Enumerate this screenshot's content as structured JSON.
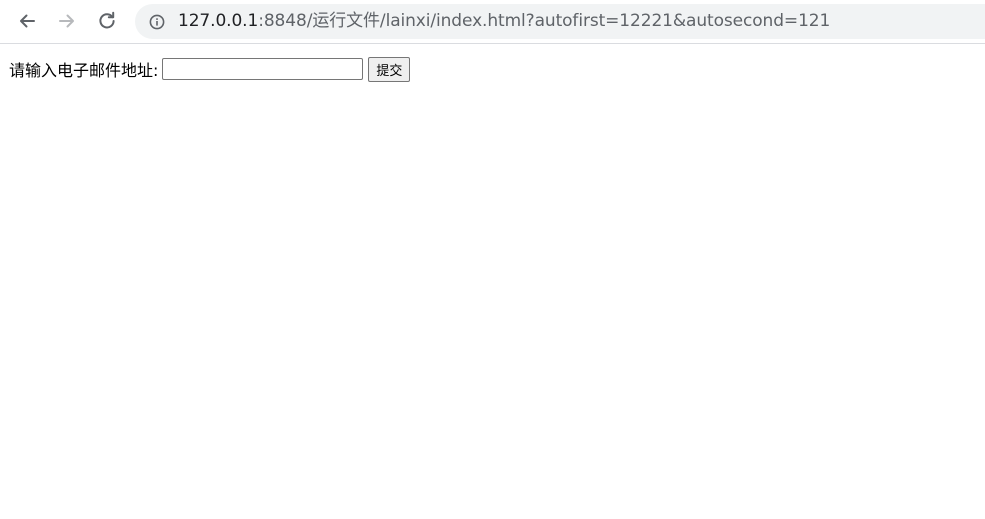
{
  "browser": {
    "url_host": "127.0.0.1",
    "url_rest": ":8848/运行文件/lainxi/index.html?autofirst=12221&autosecond=121"
  },
  "form": {
    "email_label": "请输入电子邮件地址:",
    "email_value": "",
    "submit_label": "提交"
  }
}
